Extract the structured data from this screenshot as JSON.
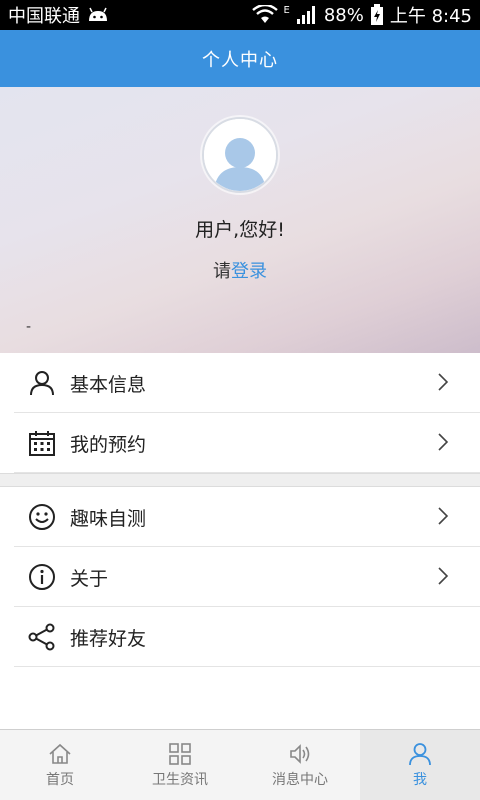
{
  "status_bar": {
    "carrier": "中国联通",
    "network_type": "E",
    "battery": "88%",
    "time": "上午 8:45"
  },
  "header": {
    "title": "个人中心"
  },
  "profile": {
    "greeting": "用户,您好!",
    "login_prefix": "请",
    "login_link": "登录",
    "placeholder": "-"
  },
  "menu": {
    "group1": [
      {
        "label": "基本信息",
        "icon": "user-icon"
      },
      {
        "label": "我的预约",
        "icon": "calendar-icon"
      }
    ],
    "group2": [
      {
        "label": "趣味自测",
        "icon": "smiley-icon"
      },
      {
        "label": "关于",
        "icon": "info-icon"
      },
      {
        "label": "推荐好友",
        "icon": "share-icon"
      }
    ]
  },
  "tabs": [
    {
      "label": "首页",
      "icon": "home-icon"
    },
    {
      "label": "卫生资讯",
      "icon": "grid-icon"
    },
    {
      "label": "消息中心",
      "icon": "speaker-icon"
    },
    {
      "label": "我",
      "icon": "user-icon",
      "active": true
    }
  ],
  "colors": {
    "accent": "#3a91de",
    "header_bg": "#3a91de"
  }
}
